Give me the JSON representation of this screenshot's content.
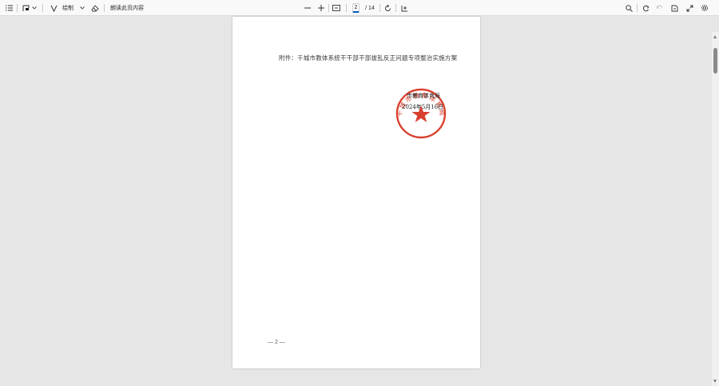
{
  "toolbar": {
    "draw_label": "绘制",
    "text_label": "朗读此页内容",
    "page_current": "2",
    "page_total": "/ 14",
    "icons": [
      "contents-icon",
      "highlight-icon",
      "draw-icon",
      "erase-icon",
      "zoom-out-icon",
      "zoom-in-icon",
      "fit-page-icon",
      "rotate-icon",
      "page-view-icon",
      "search-icon",
      "print-icon",
      "save-icon",
      "save-as-icon",
      "fullscreen-icon",
      "settings-icon"
    ]
  },
  "document": {
    "attachment_title": "附件：千城市教体系统干干部干部拔乱反正问题专项整治实施方案",
    "seal_ring_text": "千城市教育体育局",
    "seal_line1": "市教育体育局",
    "seal_line2": "2024年5月16日",
    "page_number": "— 2 —"
  },
  "colors": {
    "seal": "#d9412f",
    "accent": "#005fb8"
  }
}
